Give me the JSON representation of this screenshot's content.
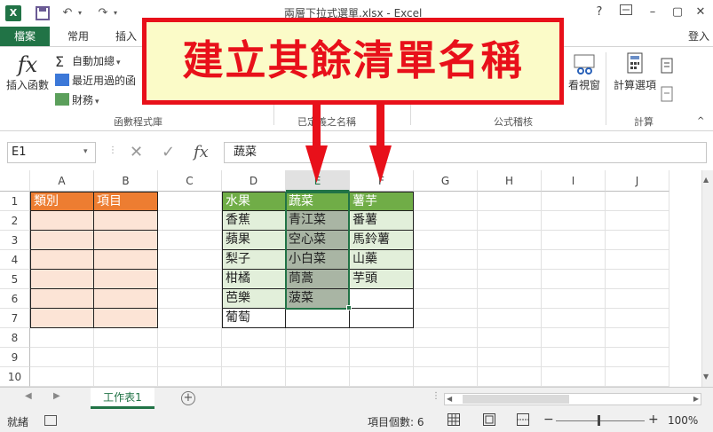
{
  "window": {
    "title": "兩層下拉式選單.xlsx - Excel",
    "app_badge": "X",
    "help": "?",
    "login": "登入"
  },
  "tabs": [
    "檔案",
    "常用",
    "插入"
  ],
  "ribbon": {
    "insert_function": "插入函數",
    "autosum": "自動加總",
    "recent": "最近用過的函",
    "financial": "財務",
    "group_function_library": "函數程式庫",
    "group_defined_names": "已定義之名稱",
    "group_formula_auditing": "公式稽核",
    "watch_window": "看視窗",
    "calc_options": "計算選項",
    "group_calculation": "計算"
  },
  "formula_bar": {
    "name_box": "E1",
    "formula": "蔬菜"
  },
  "callout": {
    "text": "建立其餘清單名稱",
    "color": "#e8101a",
    "fill": "#fbfbc8"
  },
  "sheet": {
    "columns": [
      "A",
      "B",
      "C",
      "D",
      "E",
      "F",
      "G",
      "H",
      "I",
      "J"
    ],
    "selected_column": "E",
    "rows": [
      "1",
      "2",
      "3",
      "4",
      "5",
      "6",
      "7",
      "8",
      "9",
      "10"
    ],
    "cells": {
      "A1": "類別",
      "B1": "項目",
      "D1": "水果",
      "D2": "香蕉",
      "D3": "蘋果",
      "D4": "梨子",
      "D5": "柑橘",
      "D6": "芭樂",
      "D7": "葡萄",
      "E1": "蔬菜",
      "E2": "青江菜",
      "E3": "空心菜",
      "E4": "小白菜",
      "E5": "茼蒿",
      "E6": "菠菜",
      "F1": "薯芋",
      "F2": "番薯",
      "F3": "馬鈴薯",
      "F4": "山藥",
      "F5": "芋頭"
    },
    "colors": {
      "header_orange": "#ed7d31",
      "orange_fill": "#fce4d6",
      "header_green": "#70ad47",
      "green_fill": "#e2efda",
      "selection": "#a9b5a4"
    }
  },
  "sheet_tab": "工作表1",
  "add_sheet": "+",
  "status": {
    "ready": "就緒",
    "count": "項目個數: 6",
    "zoom": "100%"
  }
}
